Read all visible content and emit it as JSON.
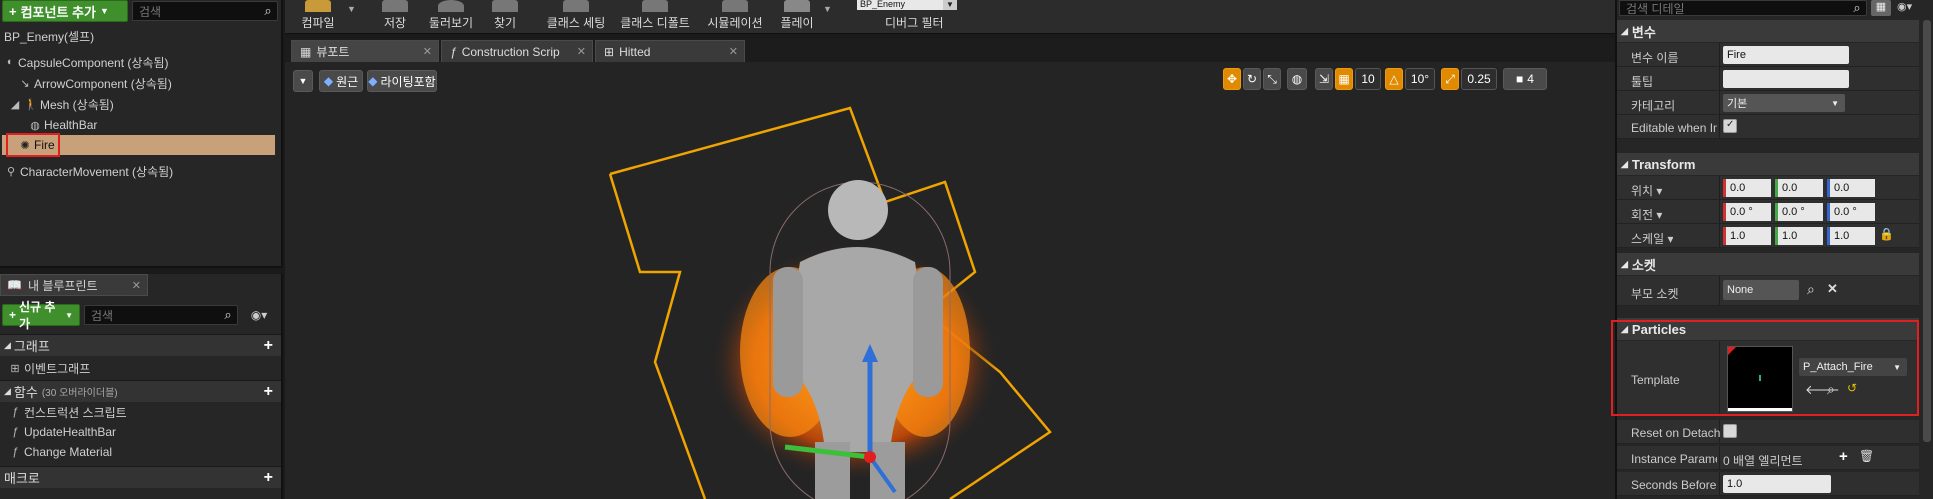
{
  "components": {
    "add_label": "컴포넌트 추가",
    "search_placeholder": "검색",
    "self_label": "BP_Enemy(셀프)",
    "items": [
      {
        "label": "CapsuleComponent (상속됨)"
      },
      {
        "label": "ArrowComponent (상속됨)"
      },
      {
        "label": "Mesh (상속됨)"
      },
      {
        "label": "HealthBar"
      },
      {
        "label": "Fire"
      },
      {
        "label": "CharacterMovement (상속됨)"
      }
    ]
  },
  "blueprint": {
    "tab_label": "내 블루프린트",
    "add_label": "신규 추가",
    "search_placeholder": "검색",
    "graph_header": "그래프",
    "event_graph": "이벤트그래프",
    "functions_header": "함수",
    "functions_overridable": "(30 오버라이더블)",
    "functions": [
      "컨스트럭션 스크립트",
      "UpdateHealthBar",
      "Change Material"
    ],
    "macros_header": "매크로"
  },
  "toolbar": {
    "buttons": [
      "컴파일",
      "저장",
      "둘러보기",
      "찾기",
      "클래스 세팅",
      "클래스 디폴트",
      "시뮬레이션",
      "플레이"
    ],
    "debug_object": "BP_Enemy",
    "debug_filter": "디버그 필터"
  },
  "tabs": [
    {
      "label": "뷰포트"
    },
    {
      "label": "Construction Scrip"
    },
    {
      "label": "Hitted"
    }
  ],
  "viewport": {
    "perspective_label": "원근",
    "lighting_label": "라이팅포함",
    "grid_snap": "10",
    "rot_snap": "10°",
    "scale_snap": "0.25",
    "cam_speed": "4"
  },
  "details": {
    "search_placeholder": "검색 디테일",
    "variable_header": "변수",
    "var_name_label": "변수 이름",
    "var_name_value": "Fire",
    "tooltip_label": "툴팁",
    "tooltip_value": "",
    "category_label": "카테고리",
    "category_value": "기본",
    "editable_label": "Editable when Inh",
    "transform_header": "Transform",
    "location_label": "위치",
    "rotation_label": "회전",
    "scale_label": "스케일",
    "location": [
      "0.0",
      "0.0",
      "0.0"
    ],
    "rotation": [
      "0.0 °",
      "0.0 °",
      "0.0 °"
    ],
    "scale": [
      "1.0",
      "1.0",
      "1.0"
    ],
    "socket_header": "소켓",
    "parent_socket_label": "부모 소켓",
    "parent_socket_value": "None",
    "particles_header": "Particles",
    "template_label": "Template",
    "template_value": "P_Attach_Fire",
    "reset_detach_label": "Reset on Detach",
    "instance_params_label": "Instance Parame",
    "instance_params_value": "0 배열 엘리먼트",
    "seconds_before_label": "Seconds Before I",
    "seconds_before_value": "1.0"
  },
  "colors": {
    "accent_green": "#3f8f2c",
    "highlight": "#c8a07a",
    "annotation_red": "#e02020",
    "selection_orange": "#f0a400"
  }
}
